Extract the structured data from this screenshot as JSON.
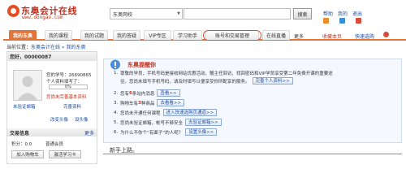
{
  "header": {
    "logo_text": "东奥会计在线",
    "logo_url": "www.dongao.com",
    "search_scope": "东奥网校",
    "search_placeholder": "",
    "search_button": "搜索",
    "top_links": [
      "帮助",
      "我的",
      "退出"
    ],
    "colors": {
      "brand": "#c0301f",
      "accent": "#e2743a",
      "link": "#1a4d9e"
    }
  },
  "nav": {
    "tabs": [
      "我的东奥",
      "我的课程",
      "我的试题",
      "我的答疑",
      "VIP专区",
      "学习助手",
      "账号和交易管理",
      "在线直播",
      "更多"
    ],
    "active_index": 0,
    "right_links": [
      "收藏本页",
      "快速选购"
    ]
  },
  "left": {
    "location_label": "当前位置：",
    "location_path": "东奥会计在线 » 我的东奥",
    "greeting": "您好，00000087",
    "learn_no": "您的学号：26690865",
    "info_status_1": "个人资料填写了：",
    "info_status_2": "0%",
    "incomplete_notice": "您尚未完善基本资料",
    "mobile_unverified": "未验证邮箱",
    "complete_link": "完善资料",
    "change_avatar": "改变头像",
    "modify_link": "设头像",
    "transactions_title": "交易信息",
    "transactions_more": "更多",
    "points": "积分：0.0",
    "level": "普通会员",
    "btn_card": "加入购物车",
    "btn_learncard": "激活学习卡"
  },
  "notice": {
    "title": "东奥提醒你",
    "items": [
      {
        "num": "1.",
        "text": "尊敬的学员，手机号码是接收网站优惠活动、赠主任回访、找回密码和VIP学员享受第二年免费开课的重要途",
        "text2": "径。您尚未填写手机号码，请及时填写以便享受你所配享的服务。",
        "btn": "完善个人资料>>"
      },
      {
        "num": "2.",
        "text_pre": "您有",
        "count": "6",
        "text_post": "条站内消息",
        "btn": "查看>>"
      },
      {
        "num": "3.",
        "text_pre": "购物车有",
        "count": "3",
        "text_post": "种商品",
        "btn": "去看看>>"
      },
      {
        "num": "4.",
        "text": "您尚未开通任何课程",
        "btn": "进入快速选购页通道>>"
      },
      {
        "num": "5.",
        "text": "您尚未验证邮箱，帐号不够安全",
        "btn": "去验证邮箱>>"
      },
      {
        "num": "6.",
        "text": "为什么不你个“有面子”的人呢？",
        "btn": "设置头像>>"
      }
    ]
  },
  "newbie": {
    "title": "新手上路。"
  }
}
